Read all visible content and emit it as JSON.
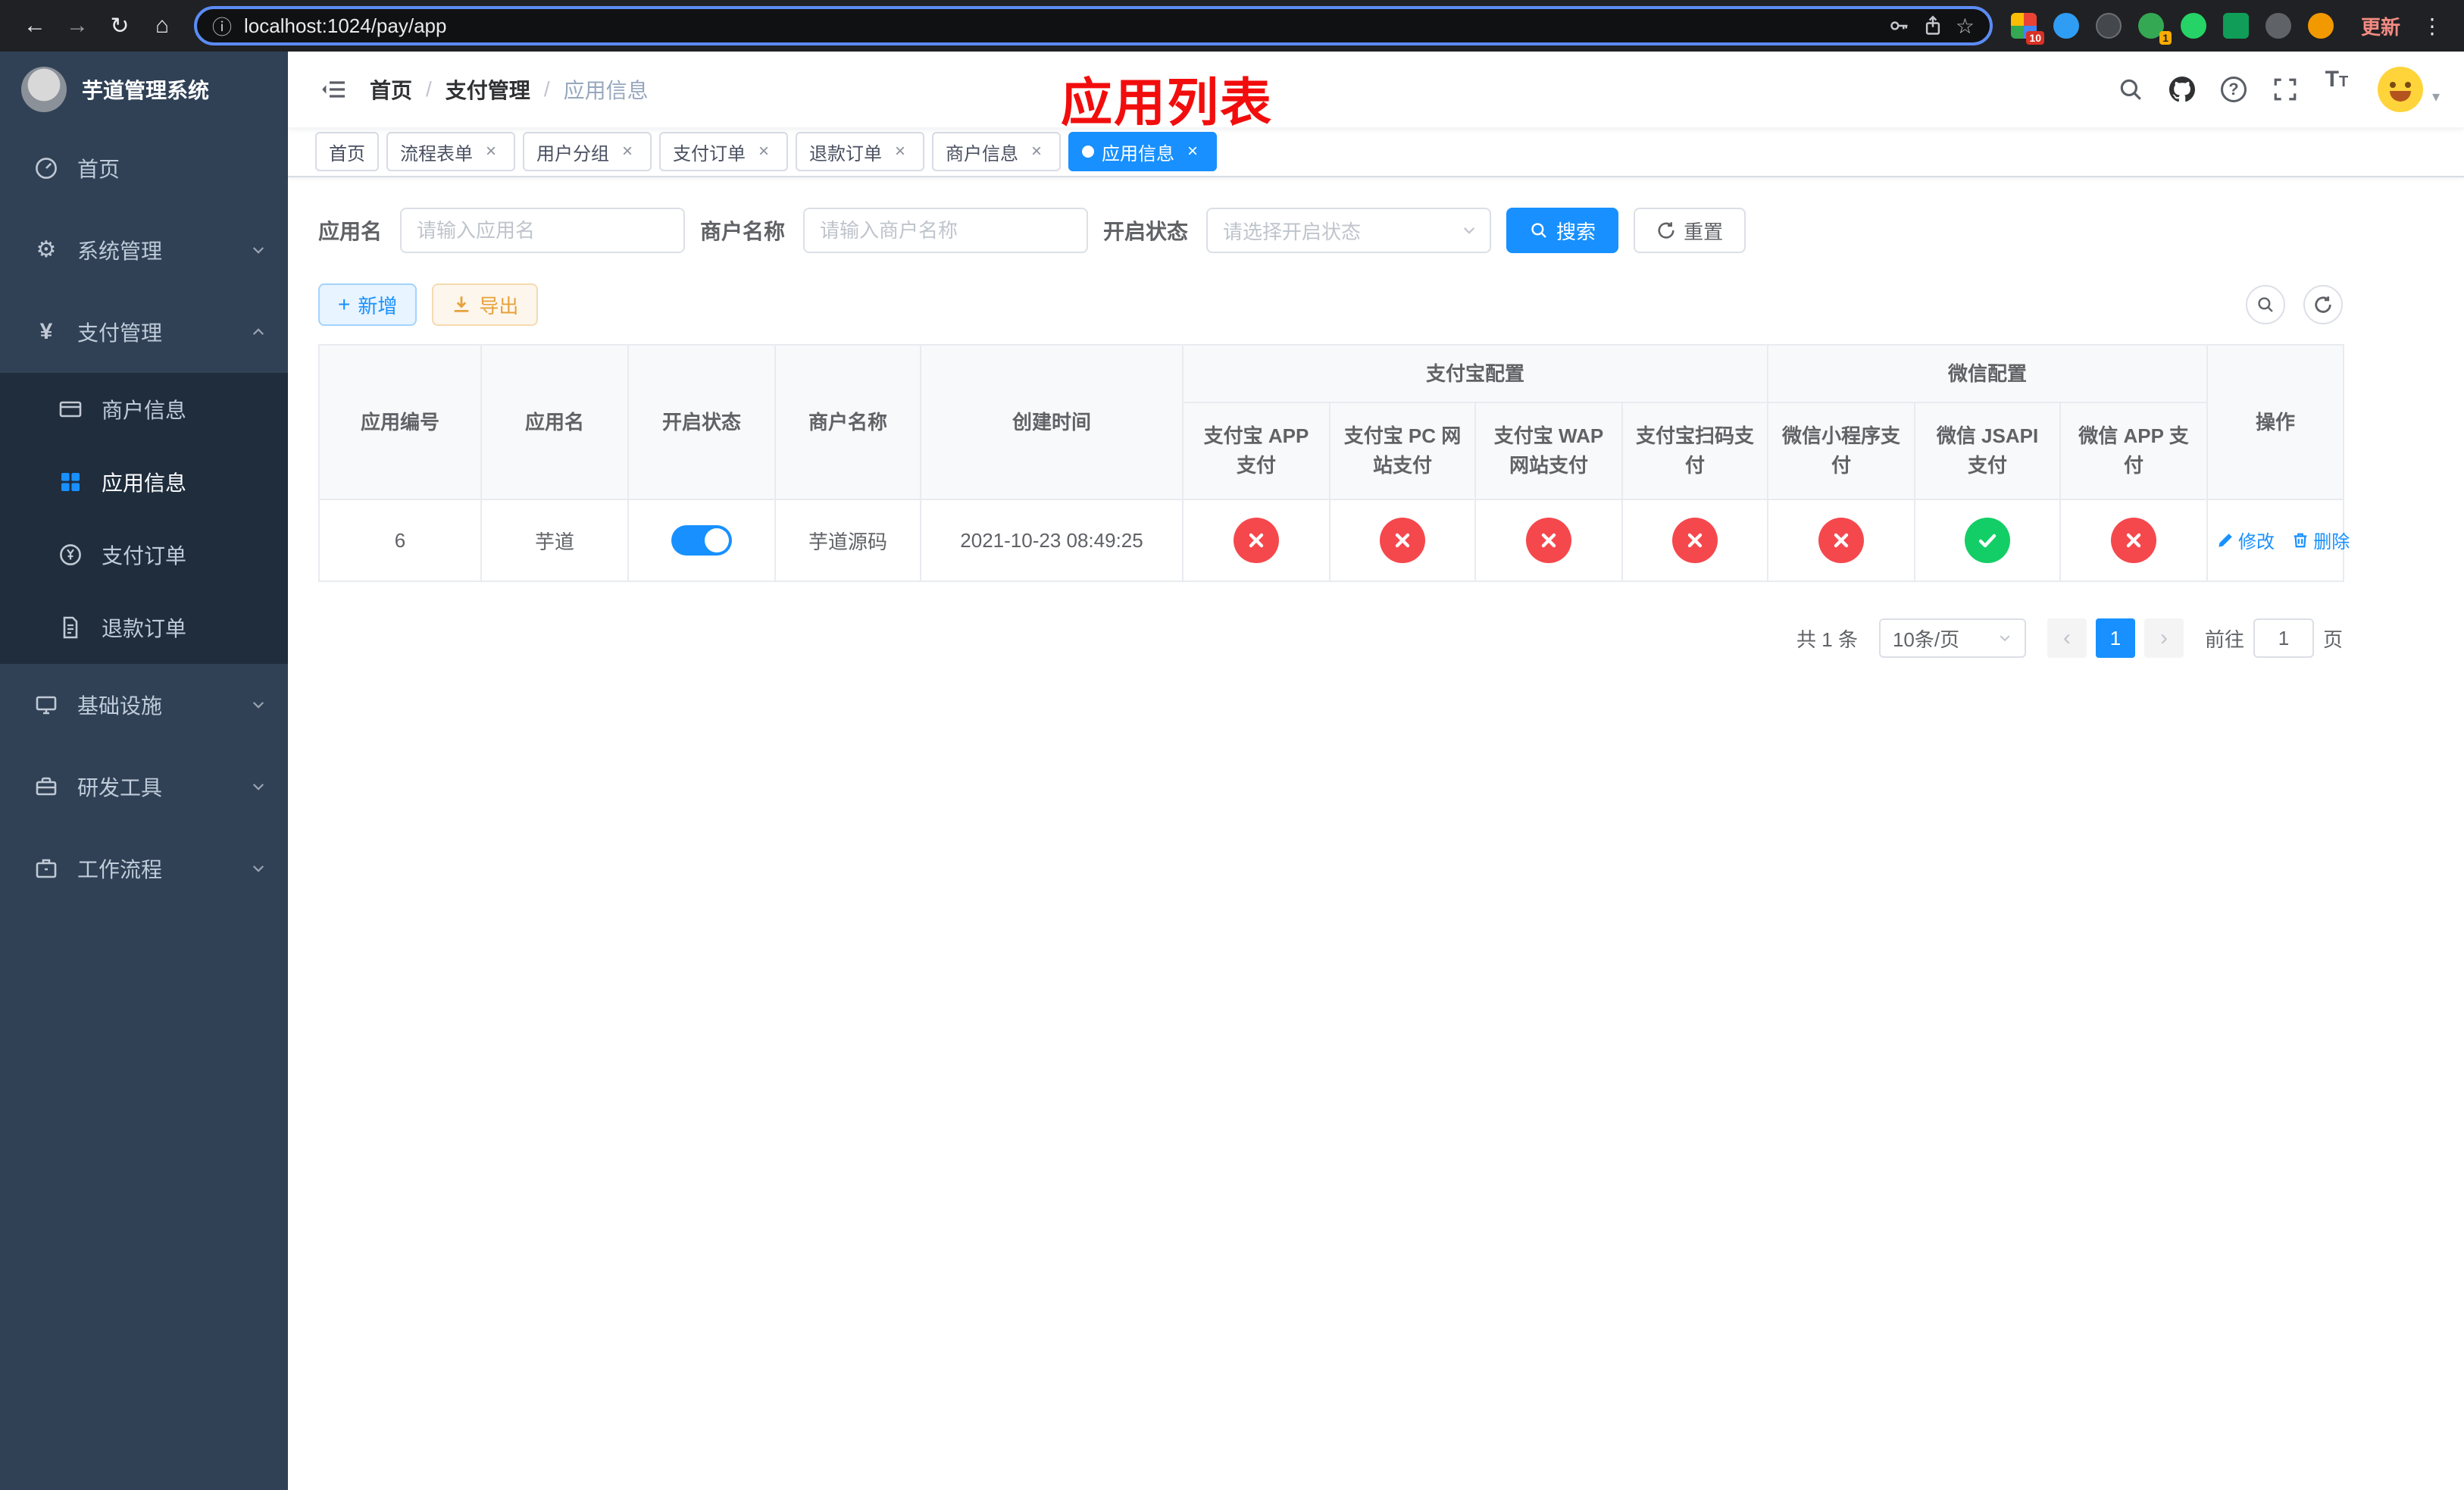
{
  "colors": {
    "accent": "#1890ff",
    "danger": "#f5484d",
    "success": "#13ce66",
    "warning": "#e6a23c",
    "sidebar_bg": "#304156"
  },
  "browser": {
    "url": "localhost:1024/pay/app",
    "update_label": "更新",
    "app_badge": "10",
    "profile_badge": "1"
  },
  "icons": {
    "back": "←",
    "forward": "→",
    "reload": "↻",
    "home": "⌂",
    "info": "ⓘ",
    "star": "☆",
    "more": "⋮",
    "gear": "⚙",
    "yen": "¥",
    "plus": "+",
    "close": "×",
    "caret": "▾",
    "help": "?",
    "prev": "‹",
    "next": "›",
    "font_large": "T",
    "font_small": "T"
  },
  "sidebar": {
    "title": "芋道管理系统",
    "items": [
      {
        "label": "首页"
      },
      {
        "label": "系统管理"
      },
      {
        "label": "支付管理",
        "children": [
          {
            "label": "商户信息"
          },
          {
            "label": "应用信息",
            "active": true
          },
          {
            "label": "支付订单"
          },
          {
            "label": "退款订单"
          }
        ]
      },
      {
        "label": "基础设施"
      },
      {
        "label": "研发工具"
      },
      {
        "label": "工作流程"
      }
    ]
  },
  "header": {
    "breadcrumb": [
      "首页",
      "支付管理",
      "应用信息"
    ],
    "annotation": "应用列表"
  },
  "tabs": [
    {
      "label": "首页",
      "closable": false
    },
    {
      "label": "流程表单",
      "closable": true
    },
    {
      "label": "用户分组",
      "closable": true
    },
    {
      "label": "支付订单",
      "closable": true
    },
    {
      "label": "退款订单",
      "closable": true
    },
    {
      "label": "商户信息",
      "closable": true
    },
    {
      "label": "应用信息",
      "closable": true,
      "active": true
    }
  ],
  "filters": {
    "app_name_label": "应用名",
    "app_name_placeholder": "请输入应用名",
    "merchant_label": "商户名称",
    "merchant_placeholder": "请输入商户名称",
    "status_label": "开启状态",
    "status_placeholder": "请选择开启状态",
    "search_label": "搜索",
    "reset_label": "重置"
  },
  "toolbar": {
    "add_label": "新增",
    "export_label": "导出"
  },
  "table": {
    "plain_columns": [
      "应用编号",
      "应用名",
      "开启状态",
      "商户名称",
      "创建时间"
    ],
    "groups": [
      {
        "label": "支付宝配置",
        "children": [
          "支付宝 APP 支付",
          "支付宝 PC 网站支付",
          "支付宝 WAP 网站支付",
          "支付宝扫码支付"
        ]
      },
      {
        "label": "微信配置",
        "children": [
          "微信小程序支付",
          "微信 JSAPI 支付",
          "微信 APP 支付"
        ]
      }
    ],
    "action_column": "操作",
    "rows": [
      {
        "id": "6",
        "name": "芋道",
        "switch": "on",
        "merchant": "芋道源码",
        "created": "2021-10-23 08:49:25",
        "configs": [
          "err",
          "err",
          "err",
          "err",
          "err",
          "ok",
          "err"
        ],
        "edit_label": "修改",
        "delete_label": "删除"
      }
    ]
  },
  "pagination": {
    "total_label": "共 1 条",
    "page_size": "10条/页",
    "page": "1",
    "goto_prefix": "前往",
    "goto_page": "1",
    "goto_suffix": "页"
  }
}
